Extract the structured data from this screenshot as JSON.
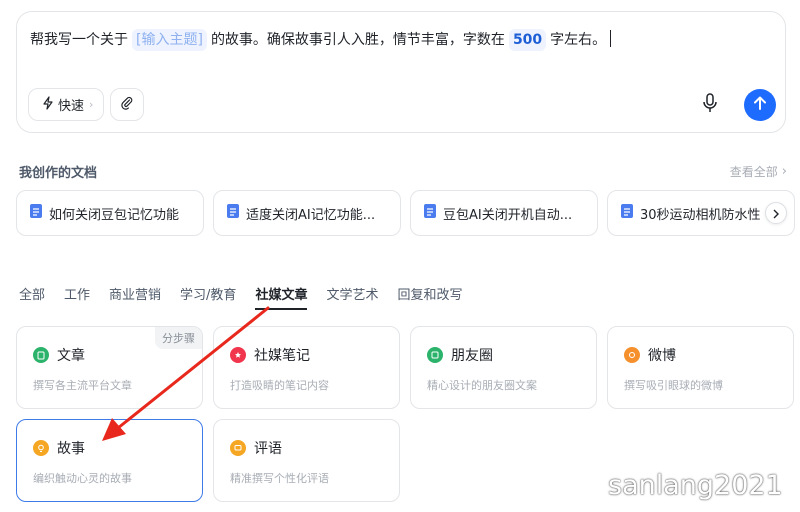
{
  "composer": {
    "prompt_before": "帮我写一个关于",
    "slot_placeholder": "[输入主题]",
    "prompt_middle": "的故事。确保故事引人入胜，情节丰富，字数在",
    "slot_number": "500",
    "prompt_after": "字左右。",
    "fast_mode_label": "快速",
    "accent_color": "#1e6bff"
  },
  "documents": {
    "title": "我创作的文档",
    "view_all": "查看全部",
    "items": [
      {
        "title": "如何关闭豆包记忆功能"
      },
      {
        "title": "适度关闭AI记忆功能..."
      },
      {
        "title": "豆包AI关闭开机自动..."
      },
      {
        "title": "30秒运动相机防水性"
      }
    ]
  },
  "tabs": [
    "全部",
    "工作",
    "商业营销",
    "学习/教育",
    "社媒文章",
    "文学艺术",
    "回复和改写"
  ],
  "active_tab": "社媒文章",
  "cards": [
    {
      "name": "文章",
      "desc": "撰写各主流平台文章",
      "badge": "分步骤",
      "icon": "document-icon",
      "color": "#2bb36b"
    },
    {
      "name": "社媒笔记",
      "desc": "打造吸睛的笔记内容",
      "icon": "note-icon",
      "color": "#f0354c"
    },
    {
      "name": "朋友圈",
      "desc": "精心设计的朋友圈文案",
      "icon": "moments-icon",
      "color": "#2bb36b"
    },
    {
      "name": "微博",
      "desc": "撰写吸引眼球的微博",
      "icon": "weibo-icon",
      "color": "#f5902c"
    },
    {
      "name": "故事",
      "desc": "编织触动心灵的故事",
      "icon": "bulb-icon",
      "color": "#f5a623"
    },
    {
      "name": "评语",
      "desc": "精准撰写个性化评语",
      "icon": "comment-icon",
      "color": "#f5a623"
    }
  ],
  "watermark": "sanlang2021"
}
